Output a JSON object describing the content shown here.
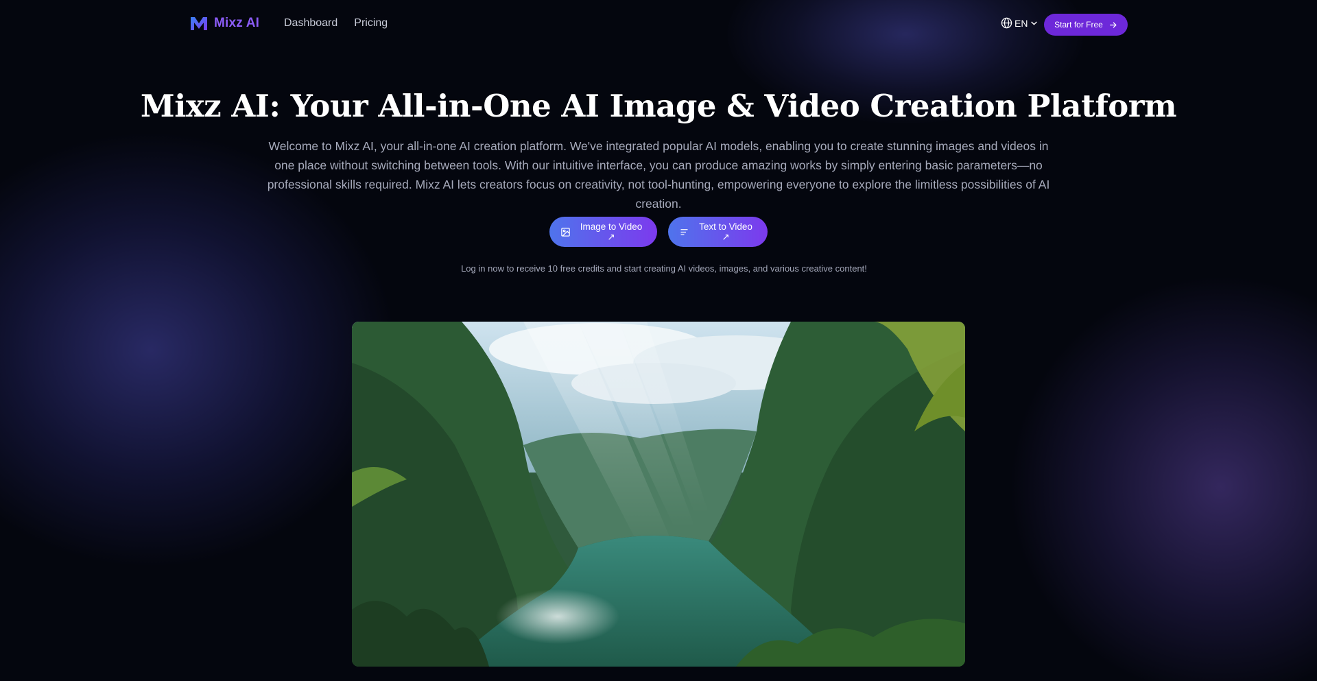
{
  "brand": {
    "name": "Mixz AI",
    "accent": "#8b5cf6"
  },
  "nav": {
    "items": [
      {
        "label": "Dashboard"
      },
      {
        "label": "Pricing"
      }
    ]
  },
  "language": {
    "selected": "EN",
    "icon": "globe-icon"
  },
  "header_cta": {
    "label": "Start for Free",
    "icon": "arrow-right-icon",
    "color": "#6d28d9"
  },
  "hero": {
    "title": "Mixz AI: Your All-in-One AI Image & Video Creation Platform",
    "description": "Welcome to Mixz AI, your all-in-one AI creation platform. We've integrated popular AI models, enabling you to create stunning images and videos in one place without switching between tools. With our intuitive interface, you can produce amazing works by simply entering basic parameters—no professional skills required. Mixz AI lets creators focus on creativity, not tool-hunting, empowering everyone to explore the limitless possibilities of AI creation.",
    "buttons": [
      {
        "label": "Image to Video ↗",
        "icon": "image-icon"
      },
      {
        "label": "Text to Video ↗",
        "icon": "text-lines-icon"
      }
    ],
    "note": "Log in now to receive 10 free credits and start creating AI videos, images, and various creative content!"
  },
  "showcase": {
    "image": "jungle-river-landscape"
  }
}
